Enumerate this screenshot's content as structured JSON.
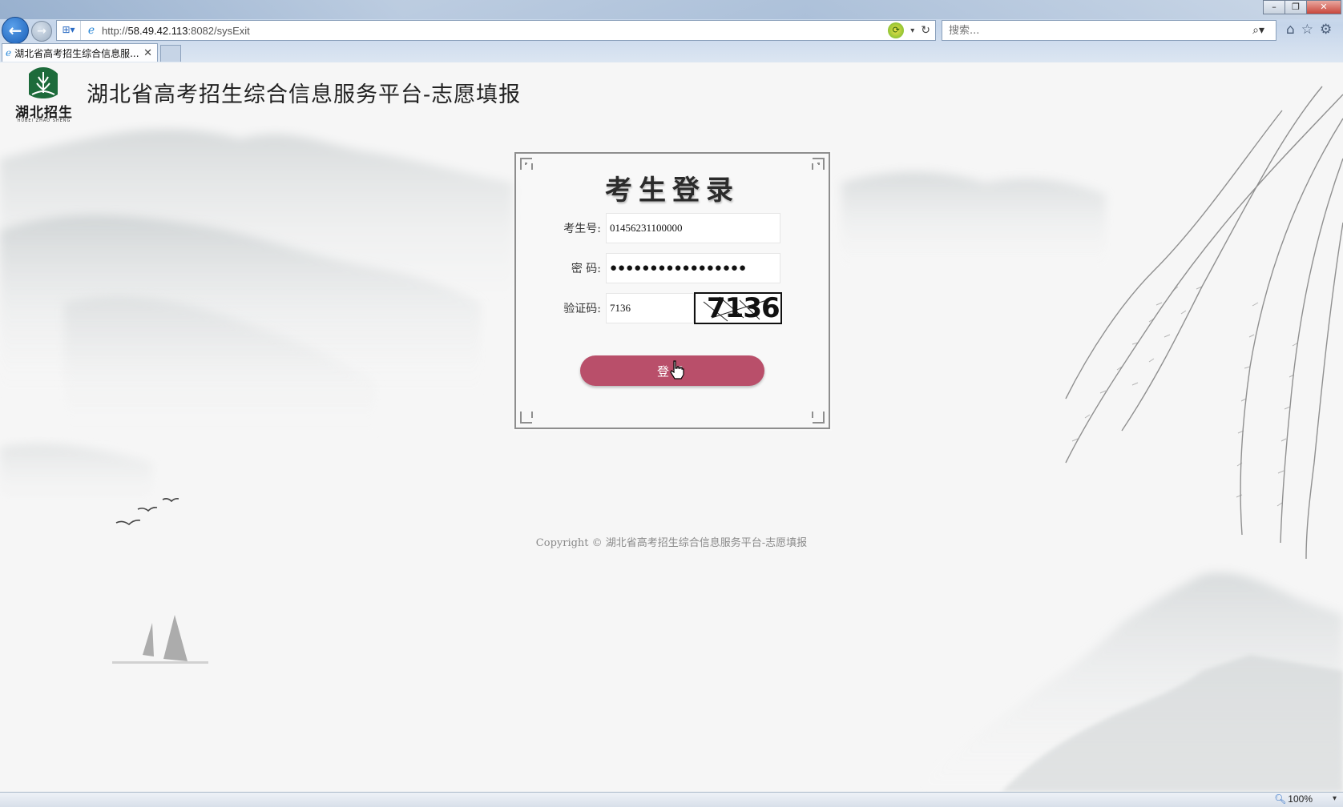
{
  "browser": {
    "address_url_prefix": "http://",
    "address_url_host": "58.49.42.113",
    "address_url_rest": ":8082/sysExit",
    "search_placeholder": "搜索...",
    "tab_title": "湖北省高考招生综合信息服...",
    "tab_close": "✕",
    "zoom_level": "100%"
  },
  "header": {
    "logo_text": "湖北招生",
    "logo_sub": "HUBEI ZHAO SHENG",
    "site_title": "湖北省高考招生综合信息服务平台-志愿填报"
  },
  "login": {
    "title": "考生登录",
    "student_id_label": "考生号:",
    "student_id_value": "01456231100000",
    "password_label": "密 码:",
    "password_value": "●●●●●●●●●●●●●●●●●",
    "captcha_label": "验证码:",
    "captcha_value": "7136",
    "captcha_image_text": "7136",
    "submit_label": "登录"
  },
  "footer": {
    "copyright": "Copyright © 湖北省高考招生综合信息服务平台-志愿填报"
  },
  "colors": {
    "login_button": "#b94f6a",
    "logo_green": "#1d6b3b"
  }
}
